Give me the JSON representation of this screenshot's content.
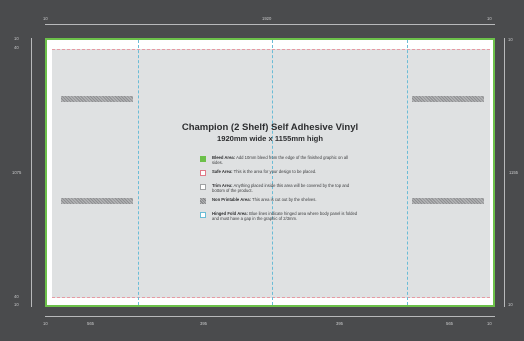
{
  "dimensions": {
    "top": [
      "10",
      "1920",
      "10"
    ],
    "left": [
      "10",
      "40",
      "1075",
      "40",
      "10"
    ],
    "right": [
      "10",
      "1155",
      "10"
    ],
    "bottom": [
      "10",
      "565",
      "395",
      "395",
      "565",
      "10"
    ]
  },
  "title": "Champion (2 Shelf) Self Adhesive Vinyl",
  "subtitle": "1920mm wide x 1155mm high",
  "legend": [
    {
      "label": "Bleed Area:",
      "text": "Add 10mm bleed from the edge of the finished graphic on all sides.",
      "swatch": "bleed",
      "color": "#6cc04a"
    },
    {
      "label": "Safe Area:",
      "text": "This is the area for your design to be placed.",
      "swatch": "safe",
      "color": "#e07a88"
    },
    {
      "label": "Trim Area:",
      "text": "Anything placed inside this area will be covered by the top and bottom of the product.",
      "swatch": "trim",
      "color": "#ffffff"
    },
    {
      "label": "Non Printable Area:",
      "text": "This area is cut out by the shelves.",
      "swatch": "non-printable",
      "color": "#9a9b9d"
    },
    {
      "label": "Hinged Fold Area:",
      "text": "Blue lines indicate hinged area where body panel is folded and must have a gap in the graphic of 2/3mm.",
      "swatch": "hinge",
      "color": "#6bbcd6"
    }
  ]
}
